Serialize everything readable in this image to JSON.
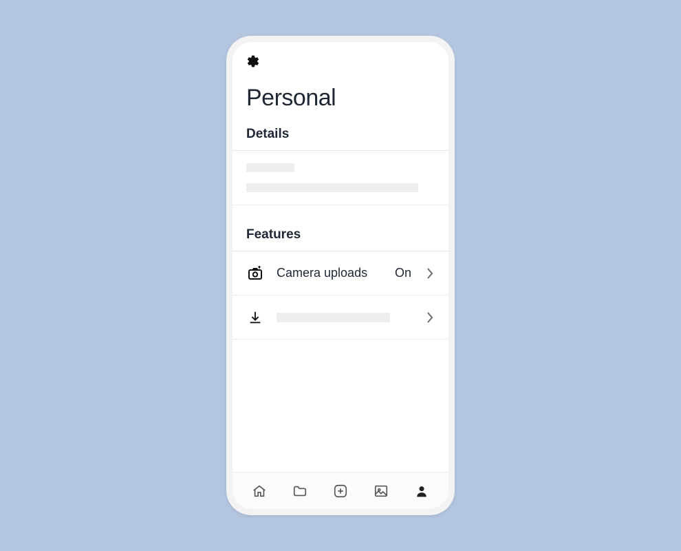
{
  "header": {
    "title": "Personal"
  },
  "sections": {
    "details": {
      "heading": "Details"
    },
    "features": {
      "heading": "Features",
      "items": {
        "camera_uploads": {
          "label": "Camera uploads",
          "value": "On"
        }
      }
    }
  },
  "icons": {
    "gear": "gear-icon",
    "camera_upload": "camera-upload-icon",
    "download": "download-icon",
    "chevron_right": "chevron-right-icon",
    "home": "home-icon",
    "folder": "folder-icon",
    "plus": "plus-circle-icon",
    "image": "image-icon",
    "person": "person-icon"
  }
}
